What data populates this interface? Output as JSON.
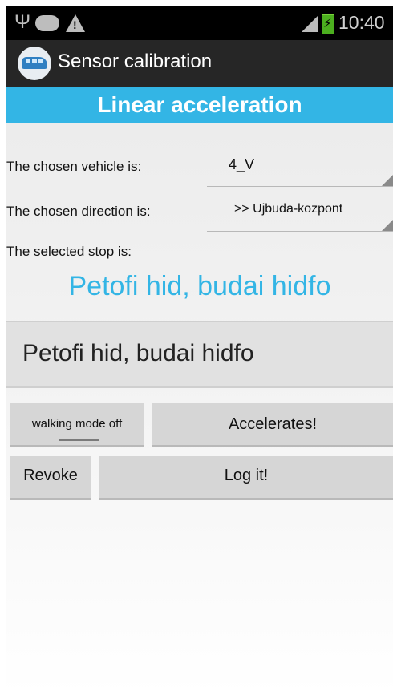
{
  "status_bar": {
    "usb_icon": "usb-icon",
    "time": "10:40"
  },
  "action_bar": {
    "title": "Sensor calibration",
    "icon": "tram-app-icon"
  },
  "banner": {
    "title": "Linear acceleration",
    "color": "#33b5e5"
  },
  "form": {
    "vehicle_label": "The chosen vehicle is:",
    "vehicle_value": "4_V",
    "direction_label": "The chosen direction is:",
    "direction_value": ">> Ujbuda-kozpont",
    "stop_label": "The selected stop is:",
    "selected_stop": "Petofi hid, budai hidfo",
    "stop_field_value": "Petofi hid, budai hidfo"
  },
  "buttons": {
    "walking_mode": "walking mode off",
    "accelerates": "Accelerates!",
    "revoke": "Revoke",
    "log_it": "Log it!"
  }
}
